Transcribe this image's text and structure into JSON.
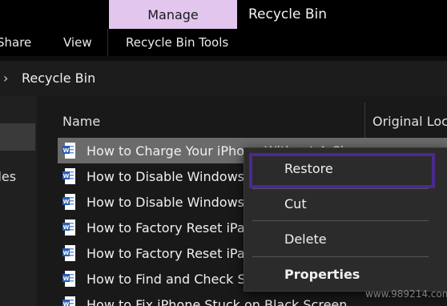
{
  "ribbon": {
    "manage_tab": "Manage",
    "window_title": "Recycle Bin",
    "tabs": [
      "Share",
      "View",
      "Recycle Bin Tools"
    ]
  },
  "address": {
    "path": "Recycle Bin"
  },
  "navpane": {
    "partial_label": "Files"
  },
  "columns": {
    "name": "Name",
    "original_location": "Original Location"
  },
  "files": [
    {
      "name": "How to Charge Your iPhone Without A Charger"
    },
    {
      "name": "How to Disable Windows"
    },
    {
      "name": "How to Disable Windows"
    },
    {
      "name": "How to Factory Reset iPad"
    },
    {
      "name": "How to Factory Reset iPad"
    },
    {
      "name": "How to Find and Check S"
    },
    {
      "name": "How to Fix iPhone Stuck on Black Screen"
    }
  ],
  "context_menu": {
    "restore": "Restore",
    "cut": "Cut",
    "delete": "Delete",
    "properties": "Properties"
  },
  "watermark": "www.989214.com",
  "colors": {
    "manage_tab_bg": "#e2c6ee",
    "selected_row_bg": "#6b6b6b",
    "restore_highlight": "#4a2a8e",
    "word_icon": "#2b5fb4"
  }
}
